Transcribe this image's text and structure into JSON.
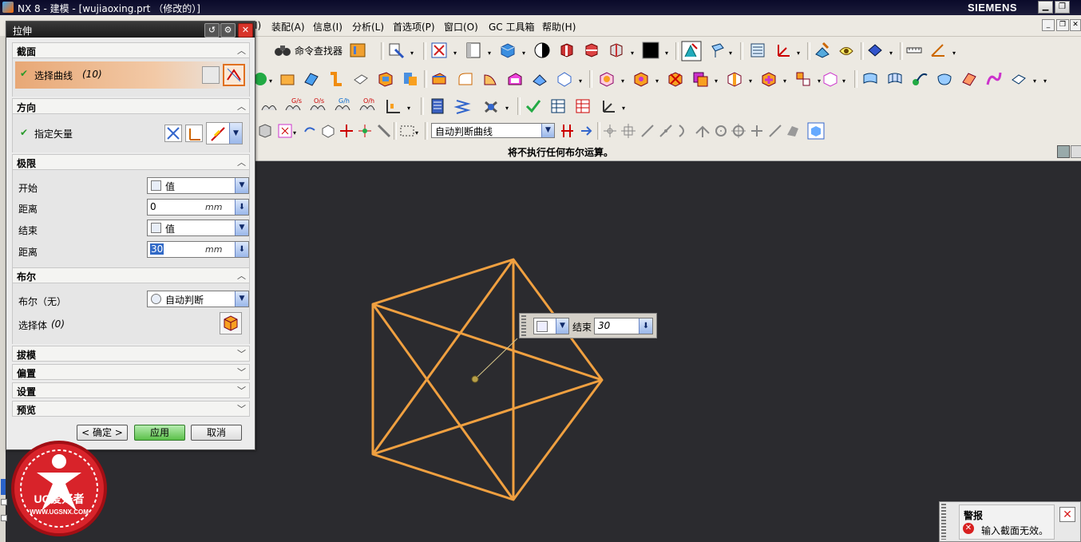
{
  "window": {
    "title": "NX 8 - 建模 - [wujiaoxing.prt （修改的）]",
    "brand": "SIEMENS"
  },
  "menu": {
    "items": [
      "装配(A)",
      "信息(I)",
      "分析(L)",
      "首选项(P)",
      "窗口(O)",
      "GC 工具箱",
      "帮助(H)"
    ],
    "partial_first": "I)"
  },
  "toolbar": {
    "command_finder": "命令查找器",
    "curve_rule": "自动判断曲线"
  },
  "status": {
    "message": "将不执行任何布尔运算。"
  },
  "dialog": {
    "title": "拉伸",
    "sections": {
      "section": {
        "title": "截面",
        "select_curve": "选择曲线",
        "count": "(10)"
      },
      "direction": {
        "title": "方向",
        "specify_vector": "指定矢量"
      },
      "limits": {
        "title": "极限",
        "start_label": "开始",
        "start_value": "值",
        "start_dist_label": "距离",
        "start_dist": "0",
        "unit1": "mm",
        "end_label": "结束",
        "end_value": "值",
        "end_dist_label": "距离",
        "end_dist": "30",
        "unit2": "mm"
      },
      "boolean": {
        "title": "布尔",
        "bool_label": "布尔（无）",
        "bool_value": "自动判断",
        "select_body": "选择体",
        "body_count": "(0)"
      },
      "draft": {
        "title": "拔模"
      },
      "offset": {
        "title": "偏置"
      },
      "settings": {
        "title": "设置"
      },
      "preview": {
        "title": "预览"
      }
    },
    "buttons": {
      "ok": "< 确定 >",
      "apply": "应用",
      "cancel": "取消"
    }
  },
  "ondim": {
    "label": "结束",
    "value": "30"
  },
  "warning": {
    "title": "警报",
    "message": "输入截面无效。"
  },
  "watermark": {
    "text1": "UG爱好者",
    "text2": "WWW.UGSNX.COM"
  },
  "colors": {
    "viewport": "#2b2b2f",
    "curve": "#f0a040",
    "accent": "#e88a3a",
    "titlebar": "#0a0a2a"
  }
}
